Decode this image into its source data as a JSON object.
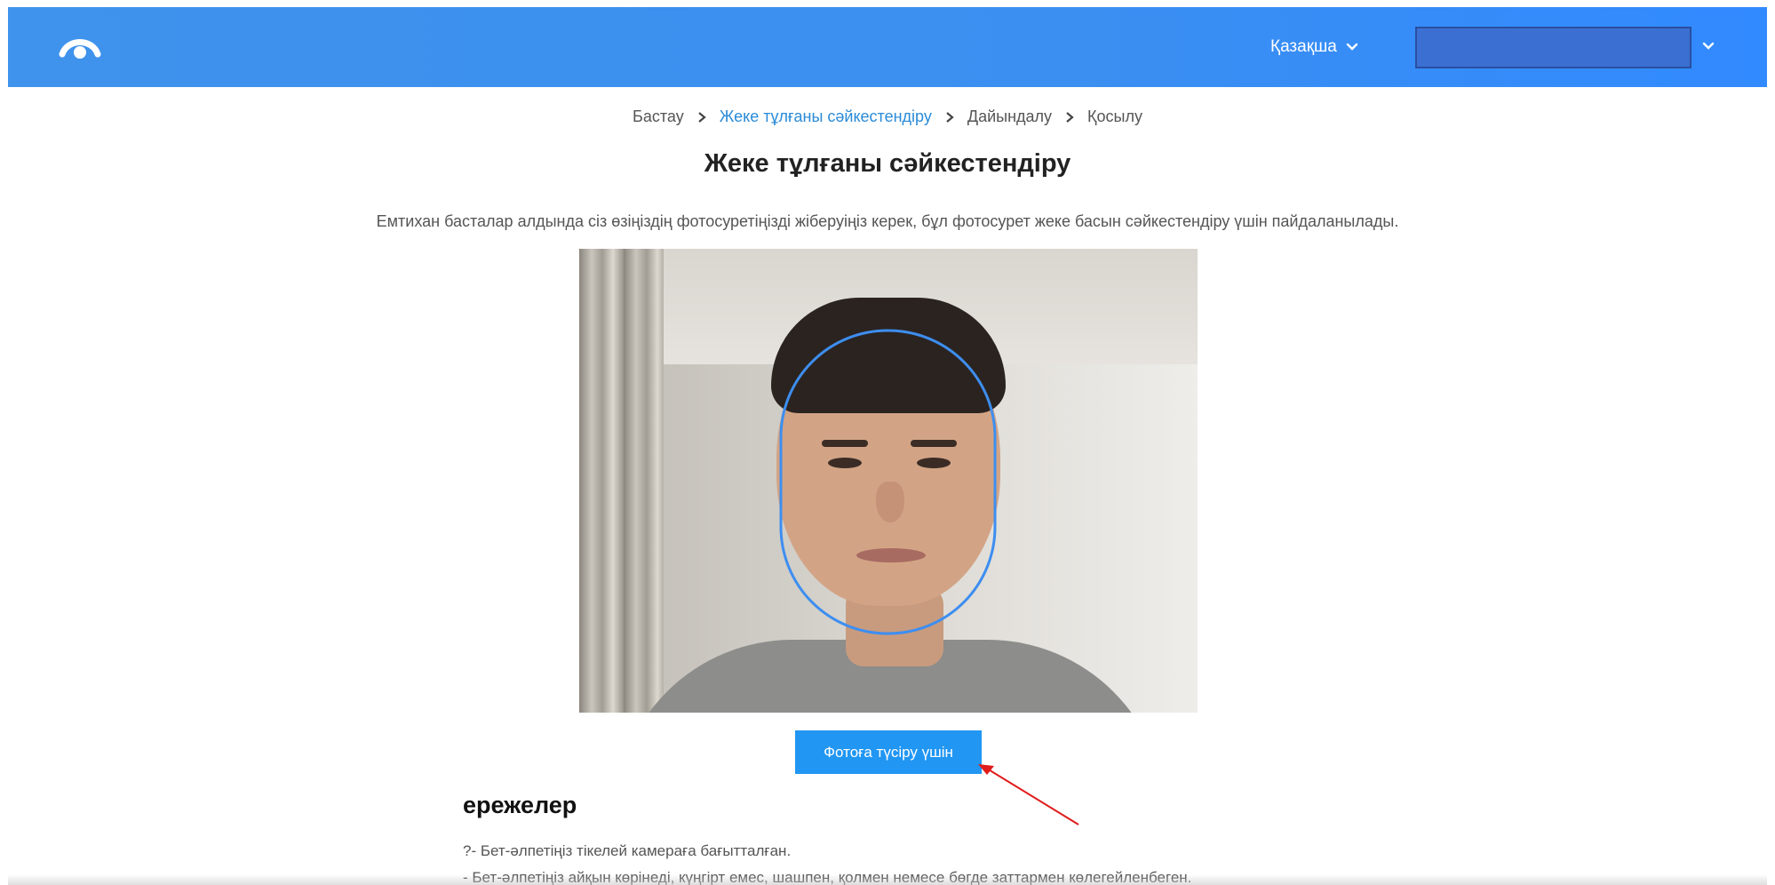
{
  "header": {
    "language": "Қазақша",
    "colors": {
      "header_bg": "#3b8ff0",
      "accent": "#2196f3",
      "breadcrumb_active": "#2a8bd8"
    }
  },
  "breadcrumb": {
    "items": [
      "Бастау",
      "Жеке тұлғаны сәйкестендіру",
      "Дайындалу",
      "Қосылу"
    ],
    "active_index": 1
  },
  "main": {
    "title": "Жеке тұлғаны сәйкестендіру",
    "description": "Емтихан басталар алдында сіз өзіңіздің фотосуретіңізді жіберуіңіз керек, бұл фотосурет жеке басын сәйкестендіру үшін пайдаланылады.",
    "capture_button": "Фотоға түсіру үшін"
  },
  "rules": {
    "title": "ережелер",
    "items": [
      "?- Бет-әлпетіңіз тікелей камераға бағытталған.",
      "- Бет-әлпетіңіз айқын көрінеді, күңгірт емес, шашпен, қолмен немесе бөгде заттармен көлегейленбеген."
    ]
  },
  "icons": [
    "eye-logo-icon",
    "chevron-down-icon",
    "chevron-right-icon",
    "face-oval-guide-icon",
    "red-arrow-annotation"
  ]
}
